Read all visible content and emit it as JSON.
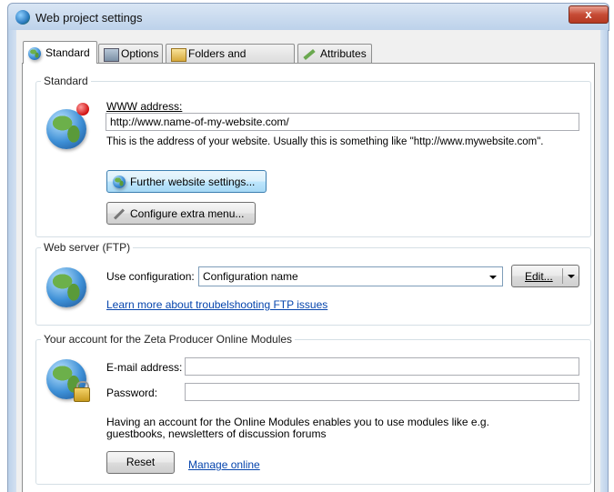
{
  "window": {
    "title": "Web project settings",
    "close_label": "x"
  },
  "tabs": [
    {
      "label": "Standard",
      "icon": "globe-icon",
      "active": true
    },
    {
      "label": "Options",
      "icon": "options-icon",
      "active": false
    },
    {
      "label": "Folders and templates",
      "icon": "folders-icon",
      "active": false
    },
    {
      "label": "Attributes",
      "icon": "attributes-icon",
      "active": false
    }
  ],
  "standard_group": {
    "legend": "Standard",
    "www_label": "WWW address:",
    "www_value": "http://www.name-of-my-website.com/",
    "www_hint": "This is the address of your website. Usually this is something like \"http://www.mywebsite.com\".",
    "further_button": "Further website settings...",
    "configure_button": "Configure extra menu..."
  },
  "ftp_group": {
    "legend": "Web server (FTP)",
    "use_config_label": "Use configuration:",
    "config_value": "Configuration name",
    "edit_button": "Edit...",
    "help_link": "Learn more about troubelshooting FTP issues"
  },
  "account_group": {
    "legend": "Your account for the Zeta Producer Online Modules",
    "email_label": "E-mail address:",
    "email_value": "",
    "password_label": "Password:",
    "password_value": "",
    "info_text": "Having an account for the Online Modules enables you to use modules like e.g. guestbooks, newsletters of discussion forums",
    "reset_button": "Reset",
    "manage_link": "Manage online"
  }
}
